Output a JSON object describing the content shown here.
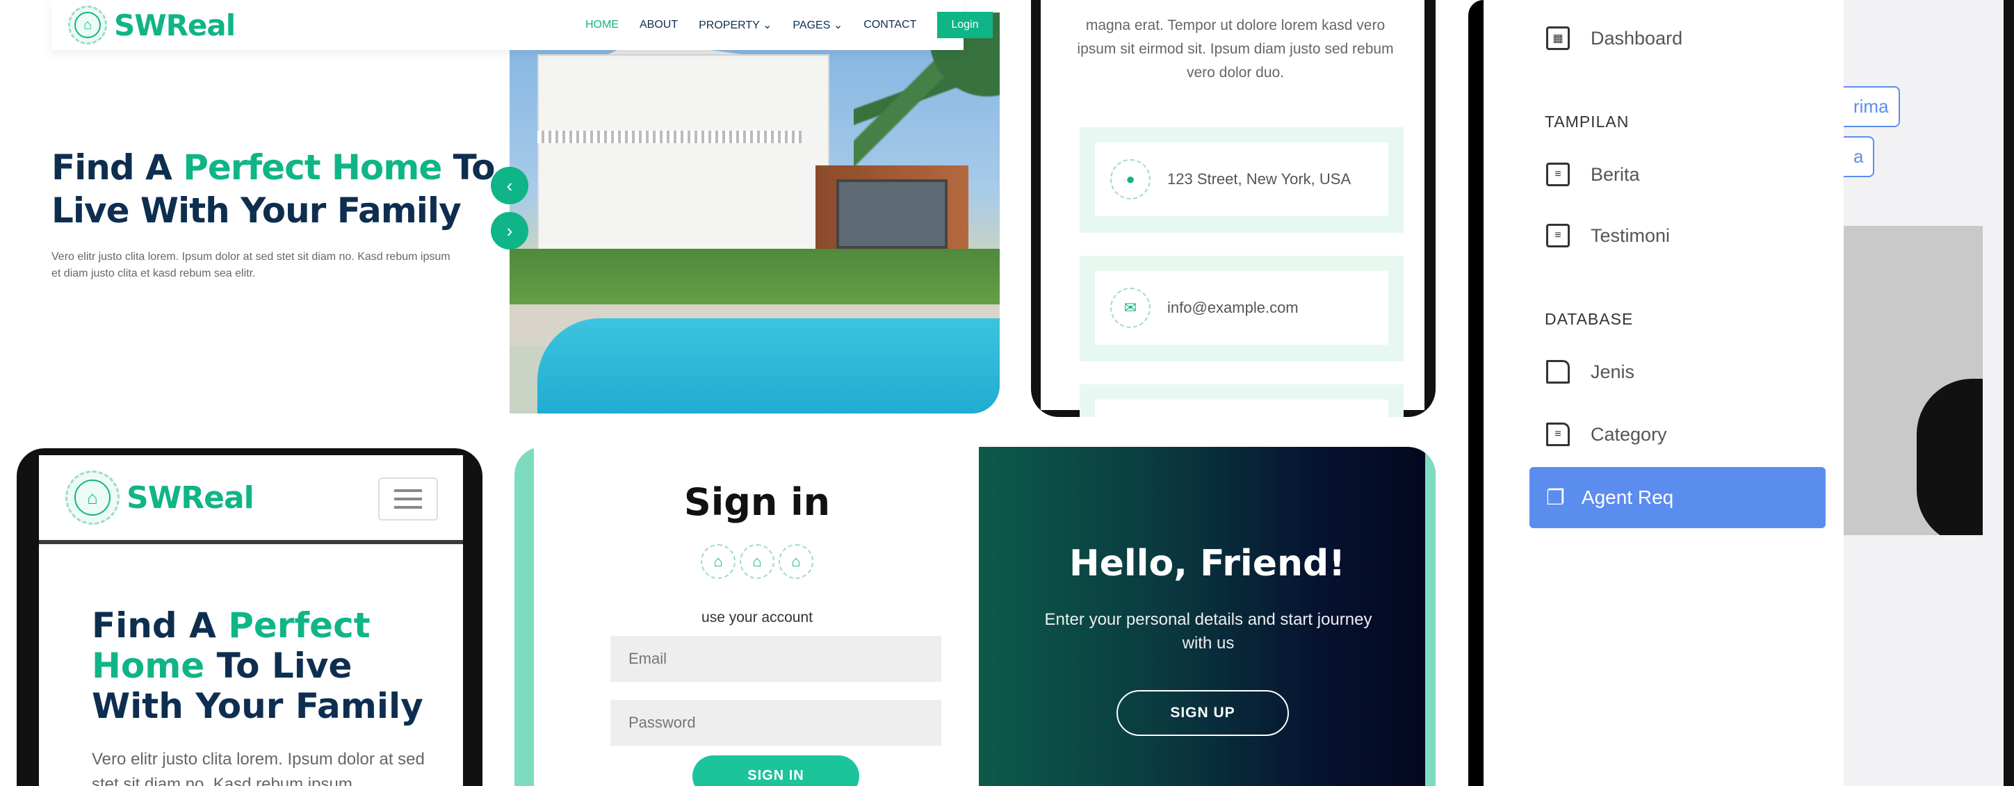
{
  "desktop": {
    "brand": "SWReal",
    "nav": [
      "HOME",
      "ABOUT",
      "PROPERTY ⌄",
      "PAGES ⌄",
      "CONTACT"
    ],
    "login": "Login",
    "hero_title_1": "Find A ",
    "hero_title_green": "Perfect Home",
    "hero_title_2": " To Live With Your Family",
    "hero_desc": "Vero elitr justo clita lorem. Ipsum dolor at sed stet sit diam no. Kasd rebum ipsum et diam justo clita et kasd rebum sea elitr."
  },
  "contact": {
    "intro": "magna erat. Tempor ut dolore lorem kasd vero ipsum sit eirmod sit. Ipsum diam justo sed rebum vero dolor duo.",
    "address": "123 Street, New York, USA",
    "email": "info@example.com"
  },
  "admin": {
    "dashboard": "Dashboard",
    "section_tampilan": "TAMPILAN",
    "berita": "Berita",
    "testimoni": "Testimoni",
    "section_database": "DATABASE",
    "jenis": "Jenis",
    "category": "Category",
    "agent_req": "Agent Req",
    "chip1": "rima",
    "chip2": "a",
    "accent": "#5b8def"
  },
  "mobile": {
    "brand": "SWReal",
    "title_1": "Find A ",
    "title_green": "Perfect Home",
    "title_2": " To Live With Your Family",
    "desc": "Vero elitr justo clita lorem. Ipsum dolor at sed stet sit diam no. Kasd rebum ipsum"
  },
  "auth": {
    "signin_title": "Sign in",
    "use_account": "use your account",
    "email_placeholder": "Email",
    "password_placeholder": "Password",
    "signin_button": "SIGN IN",
    "hello": "Hello, Friend!",
    "enter_details": "Enter your personal details and start journey with us",
    "signup_button": "SIGN UP"
  },
  "colors": {
    "brand_green": "#0fb586",
    "navy": "#0e2e50"
  }
}
